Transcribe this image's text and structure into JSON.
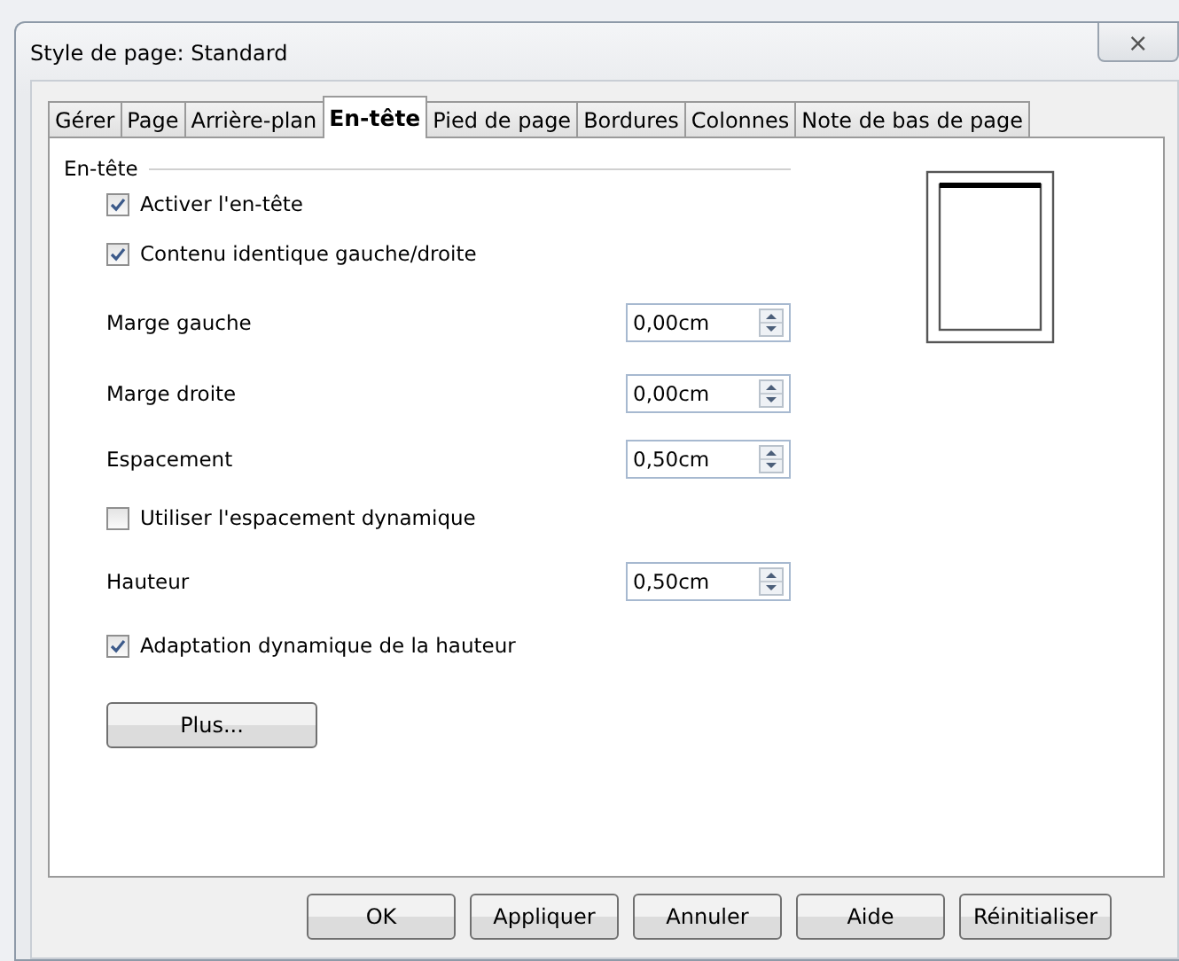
{
  "window": {
    "title": "Style de page: Standard",
    "close": "⨯"
  },
  "tabs": [
    {
      "label": "Gérer",
      "selected": false
    },
    {
      "label": "Page",
      "selected": false
    },
    {
      "label": "Arrière-plan",
      "selected": false
    },
    {
      "label": "En-tête",
      "selected": true
    },
    {
      "label": "Pied de page",
      "selected": false
    },
    {
      "label": "Bordures",
      "selected": false
    },
    {
      "label": "Colonnes",
      "selected": false
    },
    {
      "label": "Note de bas de page",
      "selected": false
    }
  ],
  "section": {
    "title": "En-tête"
  },
  "rows": [
    {
      "kind": "checkbox",
      "label": "Activer l'en-tête",
      "checked": true
    },
    {
      "kind": "checkbox",
      "label": "Contenu identique gauche/droite",
      "checked": true
    },
    {
      "kind": "spin",
      "label": "Marge gauche",
      "value": "0,00cm"
    },
    {
      "kind": "spin",
      "label": "Marge droite",
      "value": "0,00cm"
    },
    {
      "kind": "spin",
      "label": "Espacement",
      "value": "0,50cm"
    },
    {
      "kind": "checkbox",
      "label": "Utiliser l'espacement dynamique",
      "checked": false
    },
    {
      "kind": "spin",
      "label": "Hauteur",
      "value": "0,50cm"
    },
    {
      "kind": "checkbox",
      "label": "Adaptation dynamique de la hauteur",
      "checked": true
    }
  ],
  "more_button": {
    "label": "Plus..."
  },
  "buttons": [
    {
      "label": "OK"
    },
    {
      "label": "Appliquer"
    },
    {
      "label": "Annuler"
    },
    {
      "label": "Aide"
    },
    {
      "label": "Réinitialiser"
    }
  ]
}
